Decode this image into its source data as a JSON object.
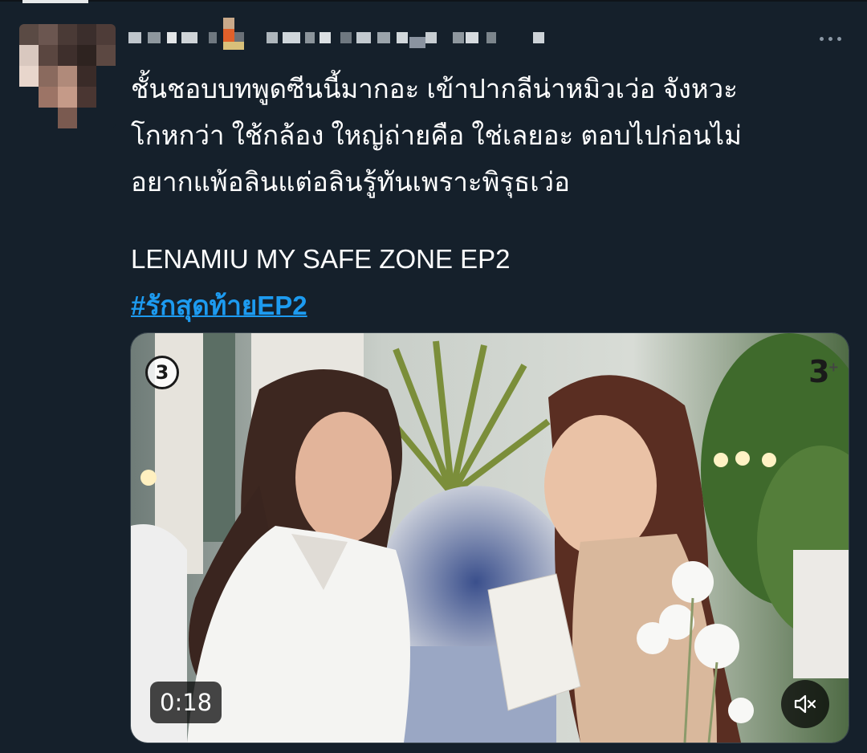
{
  "tweet": {
    "body_lines": [
      "ชั้นชอบบทพูดซีนนี้มากอะ เข้าปากลีน่าหมิวเว่อ จังหวะ",
      "โกหกว่า ใช้กล้อง ใหญ่ถ่ายคือ ใช่เลยอะ ตอบไปก่อนไม่",
      "อยากแพ้อลินแต่อลินรู้ทันเพราะพิรุธเว่อ"
    ],
    "caption": "LENAMIU MY SAFE ZONE EP2",
    "hashtag": "#รักสุดท้ายEP2"
  },
  "video": {
    "duration": "0:18",
    "channel_logo": "3",
    "channel_badge": "3",
    "channel_badge_plus": "+",
    "mute_icon": "speaker-muted-icon"
  },
  "colors": {
    "background": "#15202b",
    "text": "#ffffff",
    "link": "#1d9bf0",
    "muted": "#8b98a5"
  }
}
